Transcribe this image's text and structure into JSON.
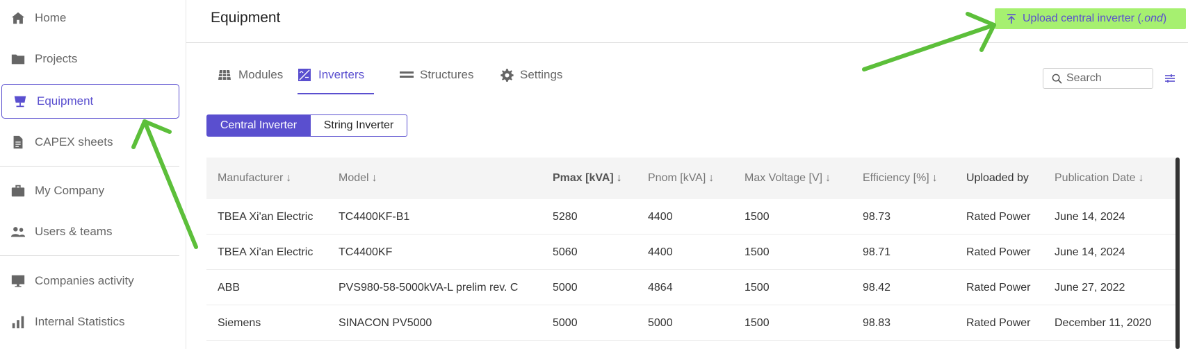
{
  "sidebar": {
    "items": [
      {
        "label": "Home",
        "icon": "home-icon"
      },
      {
        "label": "Projects",
        "icon": "folder-icon"
      },
      {
        "label": "Equipment",
        "icon": "solar-panel-icon",
        "active": true
      },
      {
        "label": "CAPEX sheets",
        "icon": "document-icon"
      },
      {
        "label": "My Company",
        "icon": "briefcase-icon"
      },
      {
        "label": "Users & teams",
        "icon": "users-icon"
      },
      {
        "label": "Companies activity",
        "icon": "monitor-icon"
      },
      {
        "label": "Internal Statistics",
        "icon": "bar-chart-icon"
      }
    ]
  },
  "header": {
    "title": "Equipment",
    "upload_label": "Upload central inverter (",
    "upload_ext": ".ond",
    "upload_close": ")"
  },
  "tabs": [
    {
      "label": "Modules",
      "icon": "grid-icon"
    },
    {
      "label": "Inverters",
      "icon": "inverter-icon",
      "active": true
    },
    {
      "label": "Structures",
      "icon": "structure-icon"
    },
    {
      "label": "Settings",
      "icon": "gear-icon"
    }
  ],
  "search": {
    "placeholder": "Search"
  },
  "segments": {
    "left": "Central Inverter",
    "right": "String Inverter",
    "selected": "left"
  },
  "table": {
    "columns": [
      {
        "label": "Manufacturer",
        "arrow": "↓"
      },
      {
        "label": "Model",
        "arrow": "↓"
      },
      {
        "label": "Pmax [kVA]",
        "arrow": "↓"
      },
      {
        "label": "Pnom [kVA]",
        "arrow": "↓"
      },
      {
        "label": "Max Voltage [V]",
        "arrow": "↓"
      },
      {
        "label": "Efficiency [%]",
        "arrow": "↓"
      },
      {
        "label": "Uploaded by",
        "arrow": ""
      },
      {
        "label": "Publication Date",
        "arrow": "↓"
      }
    ],
    "rows": [
      [
        "TBEA Xi'an Electric",
        "TC4400KF-B1",
        "5280",
        "4400",
        "1500",
        "98.73",
        "Rated Power",
        "June 14, 2024"
      ],
      [
        "TBEA Xi'an Electric",
        "TC4400KF",
        "5060",
        "4400",
        "1500",
        "98.71",
        "Rated Power",
        "June 14, 2024"
      ],
      [
        "ABB",
        "PVS980-58-5000kVA-L prelim rev. C",
        "5000",
        "4864",
        "1500",
        "98.42",
        "Rated Power",
        "June 27, 2022"
      ],
      [
        "Siemens",
        "SINACON PV5000",
        "5000",
        "5000",
        "1500",
        "98.83",
        "Rated Power",
        "December 11, 2020"
      ]
    ]
  },
  "colors": {
    "accent": "#5a4fcf",
    "upload_bg": "#a6f070",
    "annotation": "#5cbf3a"
  }
}
